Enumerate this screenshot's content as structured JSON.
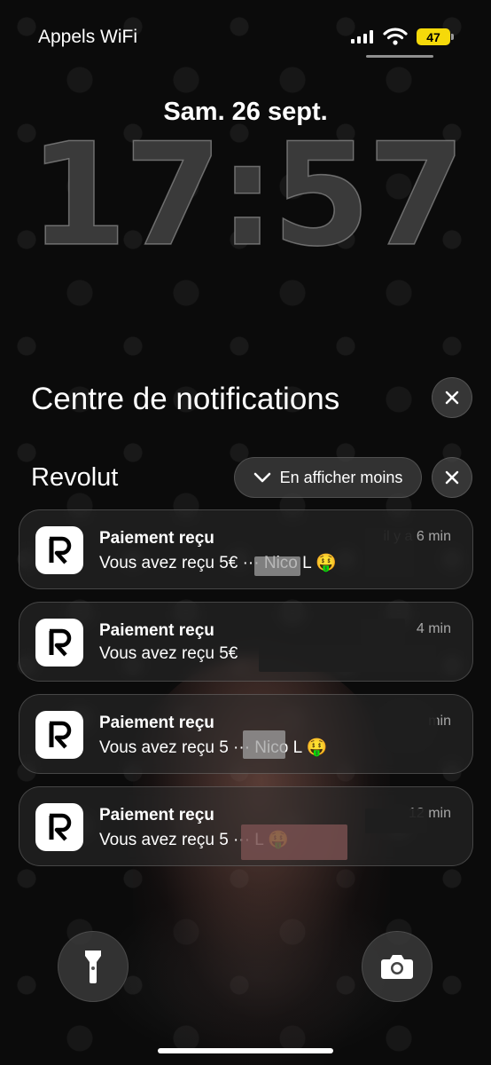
{
  "status_bar": {
    "carrier": "Appels WiFi",
    "battery_level": "47",
    "battery_color": "#f5d90a"
  },
  "lock_screen": {
    "date": "Sam. 26 sept.",
    "time": "17:57"
  },
  "notification_center": {
    "title": "Centre de notifications",
    "group": {
      "app_name": "Revolut",
      "show_less_label": "En afficher moins"
    },
    "notifications": [
      {
        "title": "Paiement reçu",
        "body": "Vous avez reçu 5€ ··· Nico L 🤑",
        "time": "il y a 6 min"
      },
      {
        "title": "Paiement reçu",
        "body": "Vous avez reçu 5€",
        "time": "4 min"
      },
      {
        "title": "Paiement reçu",
        "body": "Vous avez reçu 5 ··· Nico L 🤑",
        "time": "min"
      },
      {
        "title": "Paiement reçu",
        "body": "Vous avez reçu 5 ··· L 🤑",
        "time": "12 min"
      }
    ]
  },
  "icons": {
    "flashlight": "flashlight-icon",
    "camera": "camera-icon",
    "close": "close-icon",
    "chevron": "chevron-down-icon",
    "app": "revolut-logo-icon"
  }
}
